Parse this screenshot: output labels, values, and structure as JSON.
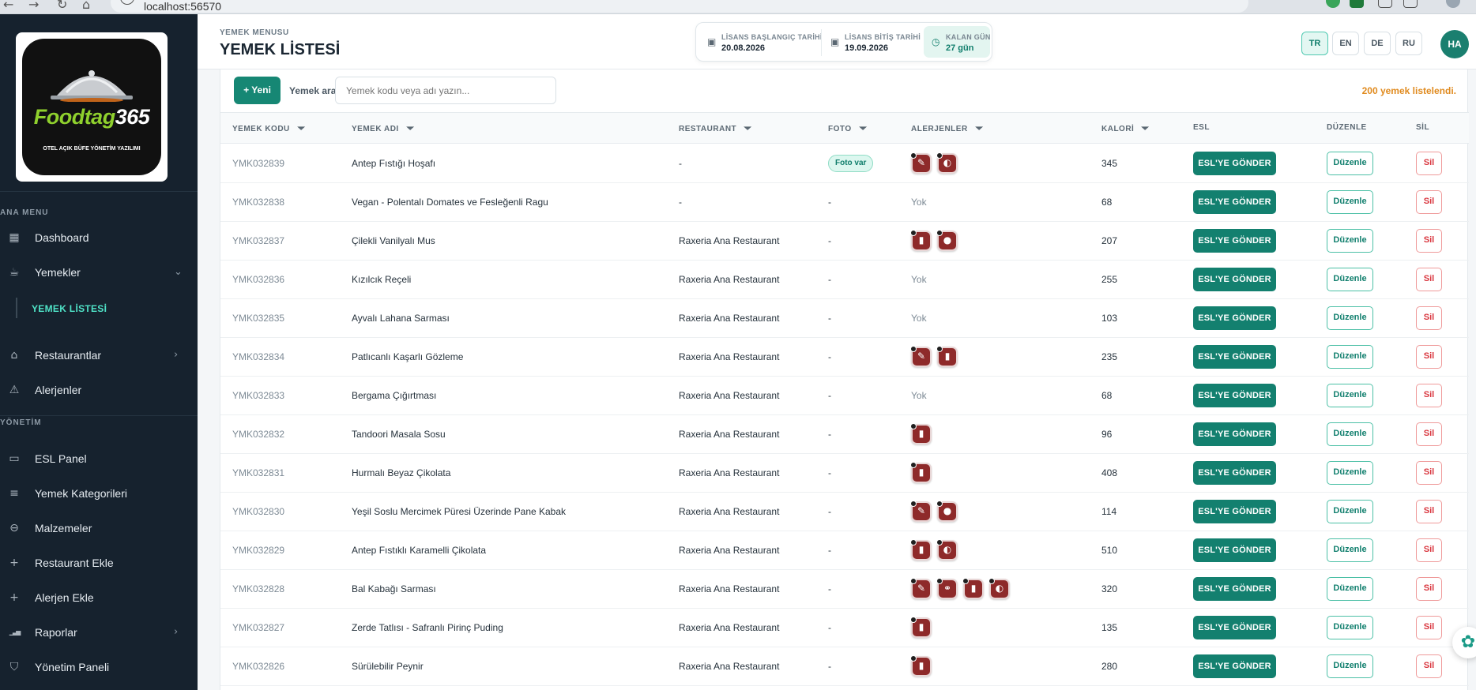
{
  "browser": {
    "url": "localhost:56570"
  },
  "sidebar": {
    "logo": {
      "brand_a": "Foodtag",
      "brand_b": "365",
      "tagline": "OTEL AÇIK BÜFE YÖNETİM YAZILIMI"
    },
    "section_main": "ANA MENU",
    "section_admin": "YÖNETİM",
    "main_items": [
      {
        "label": "Dashboard",
        "icon": "grid-icon",
        "glyph": "▦"
      },
      {
        "label": "Yemekler",
        "icon": "cup-icon",
        "glyph": "☕",
        "chevron": "⌄"
      },
      {
        "label": "Restaurantlar",
        "icon": "home-icon",
        "glyph": "⌂",
        "chevron": "›"
      },
      {
        "label": "Alerjenler",
        "icon": "warning-icon",
        "glyph": "⚠"
      }
    ],
    "sub_item": "YEMEK LİSTESİ",
    "admin_items": [
      {
        "label": "ESL Panel",
        "icon": "screen-icon",
        "glyph": "▭"
      },
      {
        "label": "Yemek Kategorileri",
        "icon": "list-icon",
        "glyph": "≡"
      },
      {
        "label": "Malzemeler",
        "icon": "dish-icon",
        "glyph": "⊖"
      },
      {
        "label": "Restaurant Ekle",
        "icon": "plus-icon",
        "glyph": "+"
      },
      {
        "label": "Alerjen Ekle",
        "icon": "plus-icon",
        "glyph": "+"
      },
      {
        "label": "Raporlar",
        "icon": "bar-chart-icon",
        "glyph": "▁▃▅",
        "chevron": "›"
      },
      {
        "label": "Yönetim Paneli",
        "icon": "shield-icon",
        "glyph": "⛉"
      }
    ]
  },
  "header": {
    "breadcrumb": "YEMEK MENUSU",
    "title": "YEMEK LİSTESİ",
    "license": {
      "start_label": "LİSANS BAŞLANGIÇ TARİHİ",
      "start_value": "20.08.2026",
      "end_label": "LİSANS BİTİŞ TARİHİ",
      "end_value": "19.09.2026",
      "remaining_label": "KALAN GÜN",
      "remaining_value": "27 gün"
    },
    "languages": [
      "TR",
      "EN",
      "DE",
      "RU"
    ],
    "active_language": "TR",
    "avatar": "HA"
  },
  "toolbar": {
    "new_label": "+ Yeni",
    "search_label": "Yemek ara",
    "search_placeholder": "Yemek kodu veya adı yazın...",
    "result_count": "200 yemek listelendi."
  },
  "table": {
    "columns": [
      "YEMEK KODU",
      "YEMEK ADI",
      "RESTAURANT",
      "FOTO",
      "ALERJENLER",
      "KALORİ",
      "ESL",
      "DÜZENLE",
      "SİL"
    ],
    "esl_label": "ESL'YE GÖNDER",
    "edit_label": "Düzenle",
    "delete_label": "Sil",
    "photo_yes": "Foto var",
    "no_allergen": "Yok",
    "rows": [
      {
        "code": "YMK032839",
        "name": "Antep Fıstığı Hoşafı",
        "restaurant": "-",
        "photo": "Foto var",
        "allergens": [
          "✎",
          "◐"
        ],
        "kcal": "345"
      },
      {
        "code": "YMK032838",
        "name": "Vegan - Polentalı Domates ve Fesleğenli Ragu",
        "restaurant": "-",
        "photo": "-",
        "allergens": [],
        "kcal": "68"
      },
      {
        "code": "YMK032837",
        "name": "Çilekli Vanilyalı Mus",
        "restaurant": "Raxeria Ana Restaurant",
        "photo": "-",
        "allergens": [
          "▮",
          "●"
        ],
        "kcal": "207"
      },
      {
        "code": "YMK032836",
        "name": "Kızılcık Reçeli",
        "restaurant": "Raxeria Ana Restaurant",
        "photo": "-",
        "allergens": [],
        "kcal": "255"
      },
      {
        "code": "YMK032835",
        "name": "Ayvalı Lahana Sarması",
        "restaurant": "Raxeria Ana Restaurant",
        "photo": "-",
        "allergens": [],
        "kcal": "103"
      },
      {
        "code": "YMK032834",
        "name": "Patlıcanlı Kaşarlı Gözleme",
        "restaurant": "Raxeria Ana Restaurant",
        "photo": "-",
        "allergens": [
          "✎",
          "▮"
        ],
        "kcal": "235"
      },
      {
        "code": "YMK032833",
        "name": "Bergama Çığırtması",
        "restaurant": "Raxeria Ana Restaurant",
        "photo": "-",
        "allergens": [],
        "kcal": "68"
      },
      {
        "code": "YMK032832",
        "name": "Tandoori Masala Sosu",
        "restaurant": "Raxeria Ana Restaurant",
        "photo": "-",
        "allergens": [
          "▮"
        ],
        "kcal": "96"
      },
      {
        "code": "YMK032831",
        "name": "Hurmalı Beyaz Çikolata",
        "restaurant": "Raxeria Ana Restaurant",
        "photo": "-",
        "allergens": [
          "▮"
        ],
        "kcal": "408"
      },
      {
        "code": "YMK032830",
        "name": "Yeşil Soslu Mercimek Püresi Üzerinde Pane Kabak",
        "restaurant": "Raxeria Ana Restaurant",
        "photo": "-",
        "allergens": [
          "✎",
          "●"
        ],
        "kcal": "114"
      },
      {
        "code": "YMK032829",
        "name": "Antep Fıstıklı Karamelli Çikolata",
        "restaurant": "Raxeria Ana Restaurant",
        "photo": "-",
        "allergens": [
          "▮",
          "◐"
        ],
        "kcal": "510"
      },
      {
        "code": "YMK032828",
        "name": "Bal Kabağı Sarması",
        "restaurant": "Raxeria Ana Restaurant",
        "photo": "-",
        "allergens": [
          "✎",
          "⚭",
          "▮",
          "◐"
        ],
        "kcal": "320"
      },
      {
        "code": "YMK032827",
        "name": "Zerde Tatlısı - Safranlı Pirinç Puding",
        "restaurant": "Raxeria Ana Restaurant",
        "photo": "-",
        "allergens": [
          "▮"
        ],
        "kcal": "135"
      },
      {
        "code": "YMK032826",
        "name": "Sürülebilir Peynir",
        "restaurant": "Raxeria Ana Restaurant",
        "photo": "-",
        "allergens": [
          "▮"
        ],
        "kcal": "280"
      }
    ]
  },
  "fab": {
    "icon": "atom-icon",
    "glyph": "✿"
  }
}
